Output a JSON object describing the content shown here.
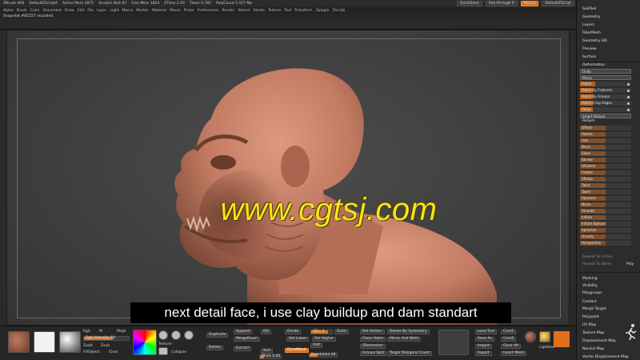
{
  "app": {
    "titlebar": [
      "ZBrush 4R6",
      "DefaultZScript4",
      "Active Mem 1875",
      "Scratch Disk 97",
      "Free Mem 1824",
      "ZTime 2.19",
      "Timer 0.785",
      "PolyCount 5.557 Mp"
    ],
    "quicksave": "QuickSave",
    "seethrough": "See-through 0",
    "menus_btn": "Menus",
    "default_script": "DefaultZScript"
  },
  "menubar": [
    "Alpha",
    "Brush",
    "Color",
    "Document",
    "Draw",
    "Edit",
    "File",
    "Layer",
    "Light",
    "Macro",
    "Marker",
    "Material",
    "Movie",
    "Picker",
    "Preferences",
    "Render",
    "Stencil",
    "Stroke",
    "Texture",
    "Tool",
    "Transform",
    "Zplugin",
    "Zscript"
  ],
  "notification": "Snapshot #85157 recorded.",
  "watermark": "www.cgtsj.com",
  "caption": "next detail face, i use clay buildup and dam standart",
  "bottom": {
    "rgb": "Rgb",
    "m": "M",
    "mrgb": "Mrgb",
    "intensity": "Rgb Intensity 64",
    "zadd": "Zadd",
    "zsub": "Zsub",
    "fillobject": "FillObject",
    "clear": "Clear",
    "ctex": "Texture",
    "ctex2": "Collapse",
    "duplicate": "Duplicate",
    "delete": "Delete",
    "append": "Append",
    "mergedown": "MergeDown",
    "extract": "Extract",
    "dq": "DQ",
    "sort": "Sort",
    "thick": "Thick 0.02",
    "divide": "Divide",
    "delLower": "Del Lower",
    "delHigher": "Del Higher",
    "sdiv": "SDiv 4",
    "add": "Add",
    "dynamesh": "DynaMesh",
    "resolution": "Resolution 64",
    "delHidden": "Del Hidden",
    "closeHoles": "Close Holes",
    "dammesh": "ZRemesher",
    "groupsSplit": "Groups Split",
    "deleteBySymmetry": "Delete By Symmetry",
    "mirrorAndWeld": "Mirror And Weld",
    "targetPolygonsCount": "Target Polygons Count",
    "loadTool": "Load Tool",
    "saveAs": "Save As",
    "import": "Import",
    "export": "Export",
    "lightbox": "Lightbox",
    "cont1": "Cont1",
    "cont2": "Cont2",
    "clearAll": "Clear All",
    "insertMesh": "Insert Mesh",
    "zadd2": "Zadd"
  },
  "rpanel": {
    "top": [
      "SubTool",
      "Geometry",
      "Layers",
      "FiberMesh",
      "Geometry HD",
      "Preview",
      "Surface",
      "Deformation"
    ],
    "deform": [
      {
        "label": "Unify",
        "fill": 0
      },
      {
        "label": "Mirror",
        "fill": 0
      },
      {
        "label": "Polish",
        "fill": 0.3
      },
      {
        "label": "Polish By Features",
        "fill": 0.25
      },
      {
        "label": "Polish By Groups",
        "fill": 0.25
      },
      {
        "label": "Polish Crisp Edges",
        "fill": 0.25
      },
      {
        "label": "Relax",
        "fill": 0.25
      }
    ],
    "smart": "Smart ReSym",
    "resym": "ReSym",
    "sliders": [
      "Offset",
      "Rotate",
      "Size",
      "Bend",
      "Skew",
      "Sknew",
      "SFlatten",
      "Flatten",
      "SRelax",
      "Twist",
      "Taper",
      "Squeeze",
      "Noise",
      "Smooth",
      "Inflate",
      "Inflate Balloon",
      "Spherize",
      "Gravity",
      "Perspective"
    ],
    "expand": [
      "Repeat To Active",
      "Repeat To Other",
      "Poly"
    ],
    "bottom": [
      "Masking",
      "Visibility",
      "Polygroups",
      "Contact",
      "Morph Target",
      "Polypaint",
      "UV Map",
      "Texture Map",
      "Displacement Map",
      "Normal Map",
      "Vector Displacement Map"
    ]
  },
  "colors": {
    "accent": "#e0701c",
    "clay": "#c27a62",
    "background": "#3f3f3f",
    "watermark": "#f6e41c"
  }
}
